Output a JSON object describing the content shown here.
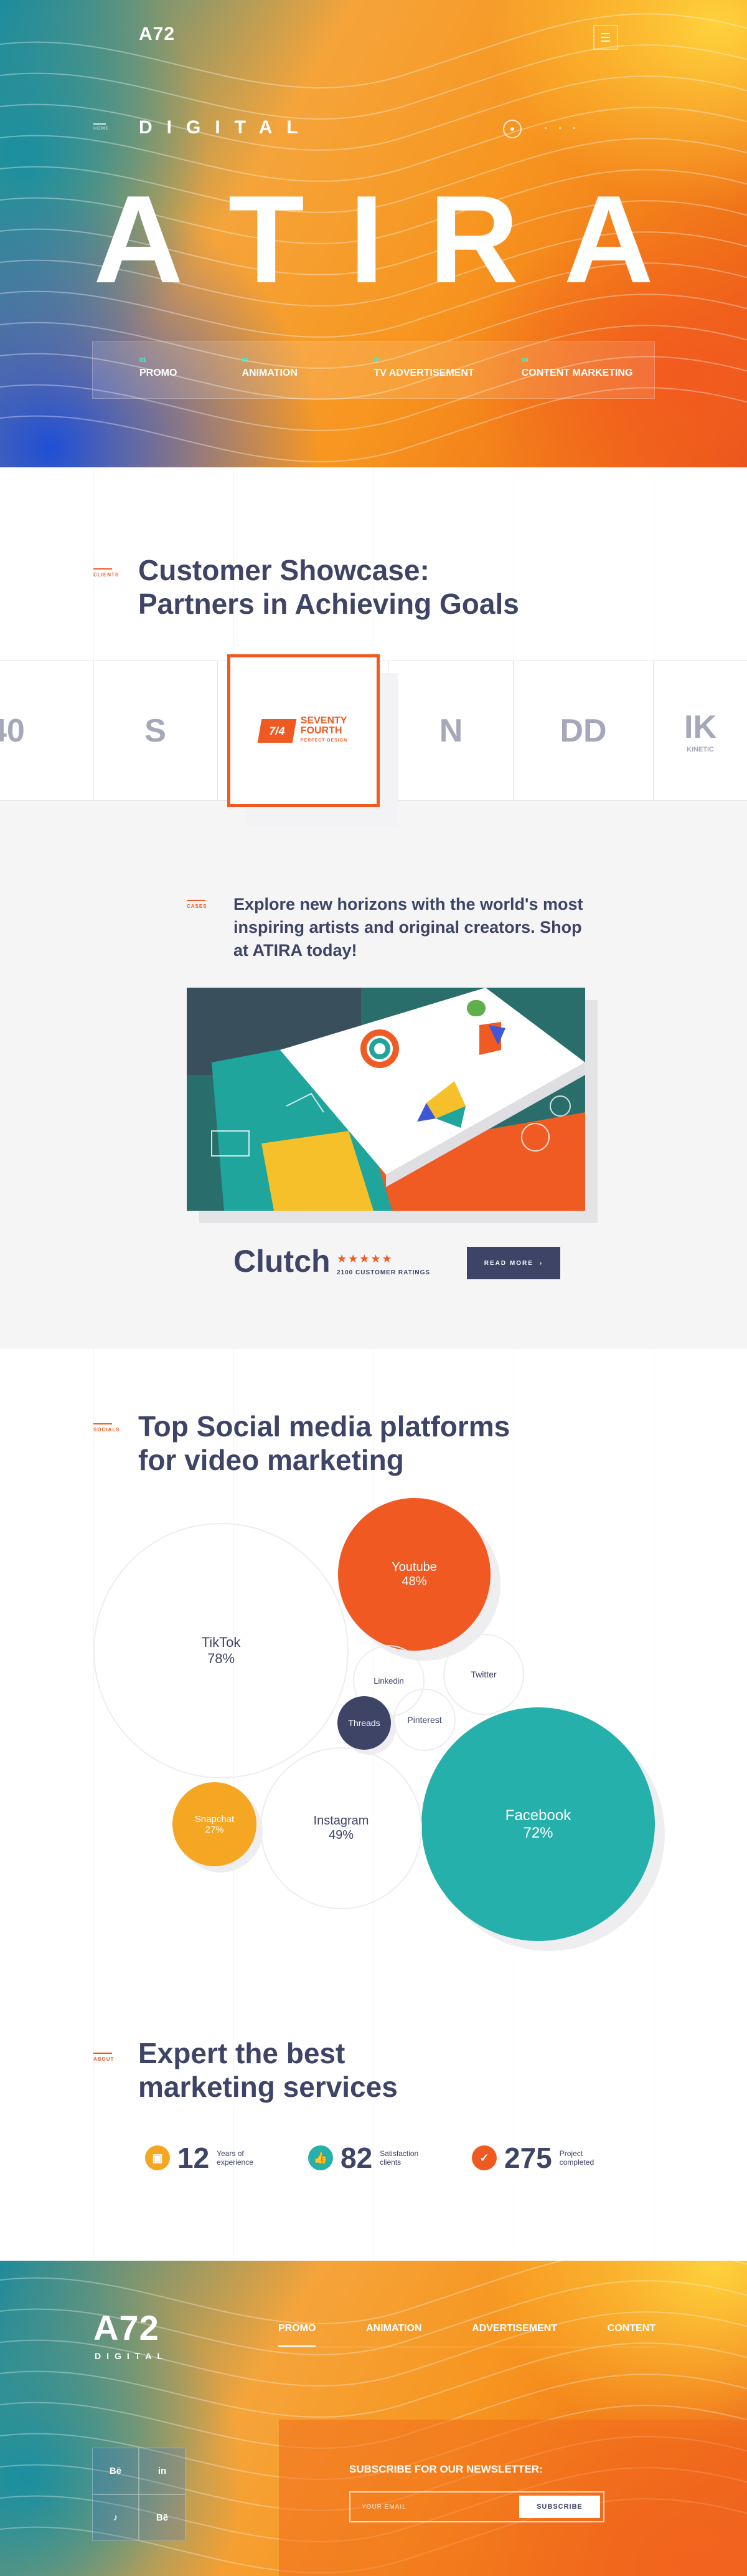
{
  "brand": {
    "logo": "A72",
    "sub": "DIGITAL"
  },
  "hero": {
    "home_tag": "HOME",
    "subtitle": "DIGITAL",
    "title_letters": [
      "A",
      "T",
      "I",
      "R",
      "A"
    ],
    "nav": [
      {
        "num": "01",
        "label": "PROMO"
      },
      {
        "num": "02",
        "label": "ANIMATION"
      },
      {
        "num": "03",
        "label": "TV ADVERTISEMENT"
      },
      {
        "num": "04",
        "label": "CONTENT MARKETING"
      }
    ]
  },
  "clients": {
    "tag": "CLIENTS",
    "title_line1": "Customer Showcase:",
    "title_line2": "Partners in Achieving Goals",
    "logos": [
      "40",
      "S",
      "N",
      "DD",
      "IK"
    ],
    "kinetic_small": "KINETIC",
    "featured": {
      "mark": "7/4",
      "line1": "SEVENTY",
      "line2": "FOURTH",
      "line3": "PERFECT DESIGN"
    }
  },
  "cases": {
    "tag": "CASES",
    "text": "Explore new horizons with the world's most inspiring artists and original creators. Shop at ATIRA today!",
    "clutch": "Clutch",
    "stars": "★★★★★",
    "ratings": "2100 CUSTOMER RATINGS",
    "read_more": "READ MORE",
    "read_more_arrow": "›"
  },
  "socials": {
    "tag": "SOCIALS",
    "title_line1": "Top Social media platforms",
    "title_line2": "for video marketing",
    "bubbles": [
      {
        "name": "TikTok",
        "value": "78%"
      },
      {
        "name": "Youtube",
        "value": "48%"
      },
      {
        "name": "Linkedin",
        "value": ""
      },
      {
        "name": "Twitter",
        "value": ""
      },
      {
        "name": "Threads",
        "value": ""
      },
      {
        "name": "Pinterest",
        "value": ""
      },
      {
        "name": "Facebook",
        "value": "72%"
      },
      {
        "name": "Snapchat",
        "value": "27%"
      },
      {
        "name": "Instagram",
        "value": "49%"
      }
    ],
    "colors": {
      "youtube": "#f05a22",
      "facebook": "#26b0ab",
      "snapchat": "#f5a623",
      "threads": "#3d4466"
    }
  },
  "about": {
    "tag": "ABOUT",
    "title_line1": "Expert the best",
    "title_line2": "marketing services",
    "stats": [
      {
        "num": "12",
        "label": "Years of experience",
        "icon": "briefcase-icon",
        "color": "#f5a623"
      },
      {
        "num": "82",
        "label": "Satisfaction clients",
        "icon": "thumbs-up-icon",
        "color": "#26b0ab"
      },
      {
        "num": "275",
        "label": "Project completed",
        "icon": "check-icon",
        "color": "#f05a22"
      }
    ]
  },
  "footer": {
    "logo": "A72",
    "sub": "DIGITAL",
    "nav": [
      "PROMO",
      "ANIMATION",
      "ADVERTISEMENT",
      "CONTENT"
    ],
    "social": [
      "Bē",
      "in",
      "♪",
      "Bē"
    ],
    "newsletter_title": "SUBSCRIBE FOR OUR NEWSLETTER:",
    "email_placeholder": "YOUR EMAIL",
    "subscribe": "SUBSCRIBE"
  },
  "colors": {
    "accent": "#f05a22",
    "dark": "#3d4466",
    "teal": "#26b0ab",
    "nav_num": "#4af0c8"
  }
}
